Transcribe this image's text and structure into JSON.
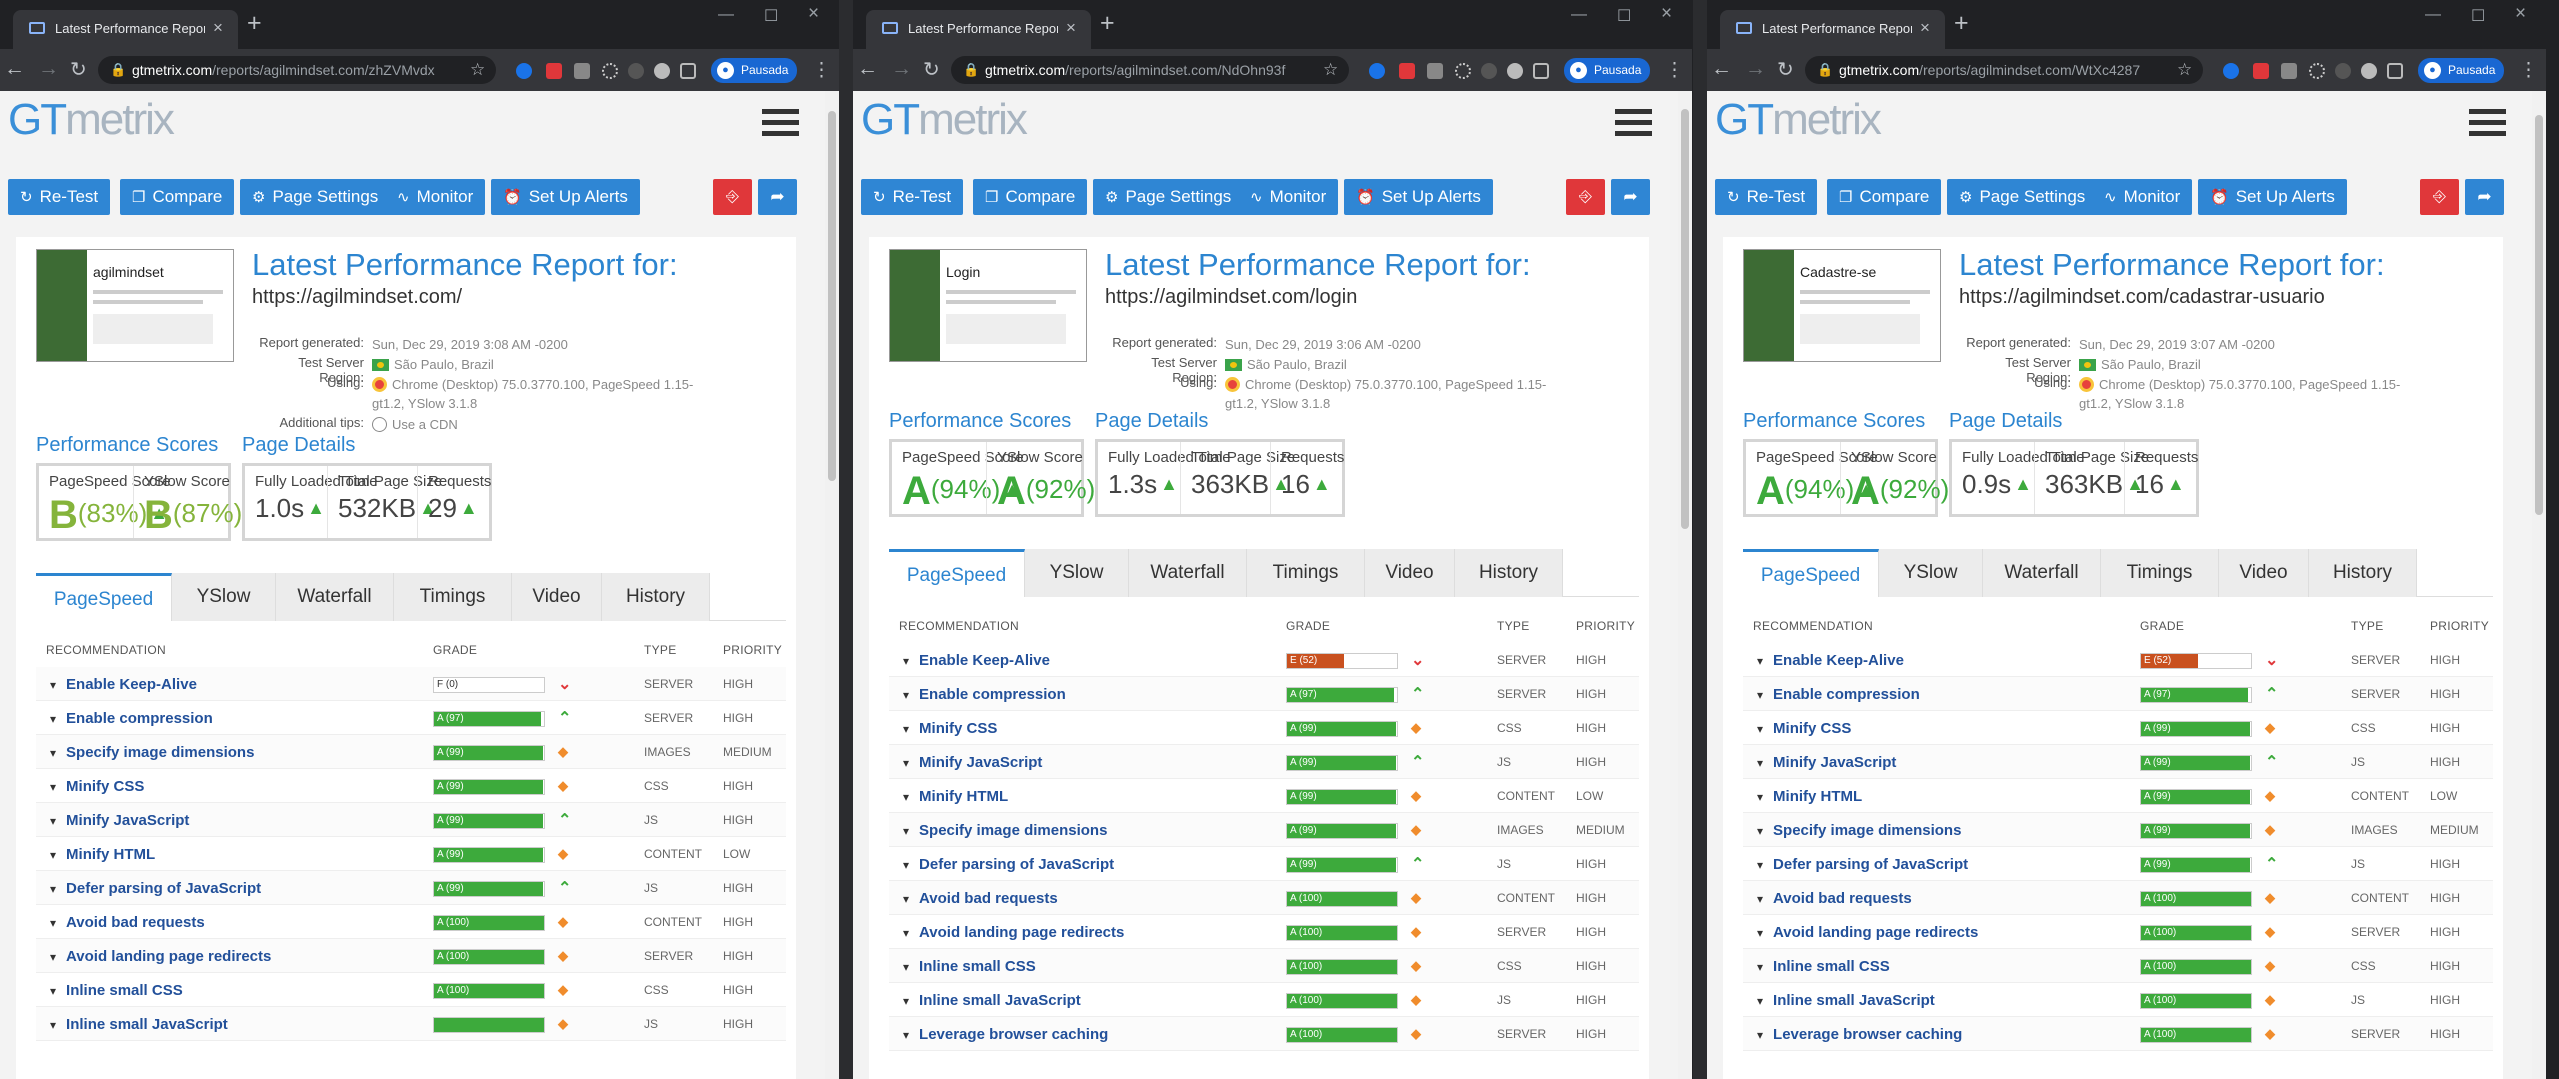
{
  "windows": [
    {
      "tab_title": "Latest Performance Report for: ht",
      "url_domain": "gtmetrix.com",
      "url_path": "/reports/agilmindset.com/zhZVMvdx",
      "pause_label": "Pausada",
      "logo_a": "GT",
      "logo_b": "metrix",
      "buttons": {
        "retest": "Re-Test",
        "compare": "Compare",
        "settings": "Page Settings",
        "monitor": "Monitor",
        "alerts": "Set Up Alerts"
      },
      "report_title": "Latest Performance Report for:",
      "report_url": "https://agilmindset.com/",
      "meta": {
        "generated_k": "Report generated:",
        "generated": "Sun, Dec 29, 2019 3:08 AM -0200",
        "region_k": "Test Server Region:",
        "region": "São Paulo, Brazil",
        "using_k": "Using:",
        "using": "Chrome (Desktop) 75.0.3770.100, PageSpeed 1.15-gt1.2, YSlow 3.1.8",
        "tips_k": "Additional tips:",
        "tips": "Use a CDN"
      },
      "thumb_text": "agilmindset",
      "perf_header": "Performance Scores",
      "details_header": "Page Details",
      "pagespeed_label": "PageSpeed Score",
      "pagespeed_grade": "B",
      "pagespeed_pct": "(83%)",
      "yslow_label": "YSlow Score",
      "yslow_grade": "B",
      "yslow_pct": "(87%)",
      "load_label": "Fully Loaded Time",
      "load": "1.0s",
      "size_label": "Total Page Size",
      "size": "532KB",
      "req_label": "Requests",
      "requests": "29",
      "tabs": [
        "PageSpeed",
        "YSlow",
        "Waterfall",
        "Timings",
        "Video",
        "History"
      ],
      "cols": {
        "rec": "RECOMMENDATION",
        "grade": "GRADE",
        "type": "TYPE",
        "priority": "PRIORITY"
      },
      "rows": [
        {
          "name": "Enable Keep-Alive",
          "grade": "F (0)",
          "score": 0,
          "type": "SERVER",
          "priority": "HIGH",
          "ind": "down"
        },
        {
          "name": "Enable compression",
          "grade": "A (97)",
          "score": 97,
          "type": "SERVER",
          "priority": "HIGH",
          "ind": "up"
        },
        {
          "name": "Specify image dimensions",
          "grade": "A (99)",
          "score": 99,
          "type": "IMAGES",
          "priority": "MEDIUM",
          "ind": "same"
        },
        {
          "name": "Minify CSS",
          "grade": "A (99)",
          "score": 99,
          "type": "CSS",
          "priority": "HIGH",
          "ind": "same"
        },
        {
          "name": "Minify JavaScript",
          "grade": "A (99)",
          "score": 99,
          "type": "JS",
          "priority": "HIGH",
          "ind": "up"
        },
        {
          "name": "Minify HTML",
          "grade": "A (99)",
          "score": 99,
          "type": "CONTENT",
          "priority": "LOW",
          "ind": "same"
        },
        {
          "name": "Defer parsing of JavaScript",
          "grade": "A (99)",
          "score": 99,
          "type": "JS",
          "priority": "HIGH",
          "ind": "up"
        },
        {
          "name": "Avoid bad requests",
          "grade": "A (100)",
          "score": 100,
          "type": "CONTENT",
          "priority": "HIGH",
          "ind": "same"
        },
        {
          "name": "Avoid landing page redirects",
          "grade": "A (100)",
          "score": 100,
          "type": "SERVER",
          "priority": "HIGH",
          "ind": "same"
        },
        {
          "name": "Inline small CSS",
          "grade": "A (100)",
          "score": 100,
          "type": "CSS",
          "priority": "HIGH",
          "ind": "same"
        },
        {
          "name": "Inline small JavaScript",
          "grade": "",
          "score": 100,
          "type": "JS",
          "priority": "HIGH",
          "ind": "same"
        }
      ]
    },
    {
      "tab_title": "Latest Performance Report for: ht",
      "url_domain": "gtmetrix.com",
      "url_path": "/reports/agilmindset.com/NdOhn93f",
      "pause_label": "Pausada",
      "logo_a": "GT",
      "logo_b": "metrix",
      "buttons": {
        "retest": "Re-Test",
        "compare": "Compare",
        "settings": "Page Settings",
        "monitor": "Monitor",
        "alerts": "Set Up Alerts"
      },
      "report_title": "Latest Performance Report for:",
      "report_url": "https://agilmindset.com/login",
      "meta": {
        "generated_k": "Report generated:",
        "generated": "Sun, Dec 29, 2019 3:06 AM -0200",
        "region_k": "Test Server Region:",
        "region": "São Paulo, Brazil",
        "using_k": "Using:",
        "using": "Chrome (Desktop) 75.0.3770.100, PageSpeed 1.15-gt1.2, YSlow 3.1.8",
        "tips_k": "",
        "tips": ""
      },
      "thumb_text": "Login",
      "perf_header": "Performance Scores",
      "details_header": "Page Details",
      "pagespeed_label": "PageSpeed Score",
      "pagespeed_grade": "A",
      "pagespeed_pct": "(94%)",
      "yslow_label": "YSlow Score",
      "yslow_grade": "A",
      "yslow_pct": "(92%)",
      "load_label": "Fully Loaded Time",
      "load": "1.3s",
      "size_label": "Total Page Size",
      "size": "363KB",
      "req_label": "Requests",
      "requests": "16",
      "tabs": [
        "PageSpeed",
        "YSlow",
        "Waterfall",
        "Timings",
        "Video",
        "History"
      ],
      "cols": {
        "rec": "RECOMMENDATION",
        "grade": "GRADE",
        "type": "TYPE",
        "priority": "PRIORITY"
      },
      "rows": [
        {
          "name": "Enable Keep-Alive",
          "grade": "E (52)",
          "score": 52,
          "type": "SERVER",
          "priority": "HIGH",
          "ind": "down"
        },
        {
          "name": "Enable compression",
          "grade": "A (97)",
          "score": 97,
          "type": "SERVER",
          "priority": "HIGH",
          "ind": "up"
        },
        {
          "name": "Minify CSS",
          "grade": "A (99)",
          "score": 99,
          "type": "CSS",
          "priority": "HIGH",
          "ind": "same"
        },
        {
          "name": "Minify JavaScript",
          "grade": "A (99)",
          "score": 99,
          "type": "JS",
          "priority": "HIGH",
          "ind": "up"
        },
        {
          "name": "Minify HTML",
          "grade": "A (99)",
          "score": 99,
          "type": "CONTENT",
          "priority": "LOW",
          "ind": "same"
        },
        {
          "name": "Specify image dimensions",
          "grade": "A (99)",
          "score": 99,
          "type": "IMAGES",
          "priority": "MEDIUM",
          "ind": "same"
        },
        {
          "name": "Defer parsing of JavaScript",
          "grade": "A (99)",
          "score": 99,
          "type": "JS",
          "priority": "HIGH",
          "ind": "up"
        },
        {
          "name": "Avoid bad requests",
          "grade": "A (100)",
          "score": 100,
          "type": "CONTENT",
          "priority": "HIGH",
          "ind": "same"
        },
        {
          "name": "Avoid landing page redirects",
          "grade": "A (100)",
          "score": 100,
          "type": "SERVER",
          "priority": "HIGH",
          "ind": "same"
        },
        {
          "name": "Inline small CSS",
          "grade": "A (100)",
          "score": 100,
          "type": "CSS",
          "priority": "HIGH",
          "ind": "same"
        },
        {
          "name": "Inline small JavaScript",
          "grade": "A (100)",
          "score": 100,
          "type": "JS",
          "priority": "HIGH",
          "ind": "same"
        },
        {
          "name": "Leverage browser caching",
          "grade": "A (100)",
          "score": 100,
          "type": "SERVER",
          "priority": "HIGH",
          "ind": "same"
        }
      ]
    },
    {
      "tab_title": "Latest Performance Report for: ht",
      "url_domain": "gtmetrix.com",
      "url_path": "/reports/agilmindset.com/WtXc4287",
      "pause_label": "Pausada",
      "logo_a": "GT",
      "logo_b": "metrix",
      "buttons": {
        "retest": "Re-Test",
        "compare": "Compare",
        "settings": "Page Settings",
        "monitor": "Monitor",
        "alerts": "Set Up Alerts"
      },
      "report_title": "Latest Performance Report for:",
      "report_url": "https://agilmindset.com/cadastrar-usuario",
      "meta": {
        "generated_k": "Report generated:",
        "generated": "Sun, Dec 29, 2019 3:07 AM -0200",
        "region_k": "Test Server Region:",
        "region": "São Paulo, Brazil",
        "using_k": "Using:",
        "using": "Chrome (Desktop) 75.0.3770.100, PageSpeed 1.15-gt1.2, YSlow 3.1.8",
        "tips_k": "",
        "tips": ""
      },
      "thumb_text": "Cadastre-se",
      "perf_header": "Performance Scores",
      "details_header": "Page Details",
      "pagespeed_label": "PageSpeed Score",
      "pagespeed_grade": "A",
      "pagespeed_pct": "(94%)",
      "yslow_label": "YSlow Score",
      "yslow_grade": "A",
      "yslow_pct": "(92%)",
      "load_label": "Fully Loaded Time",
      "load": "0.9s",
      "size_label": "Total Page Size",
      "size": "363KB",
      "req_label": "Requests",
      "requests": "16",
      "tabs": [
        "PageSpeed",
        "YSlow",
        "Waterfall",
        "Timings",
        "Video",
        "History"
      ],
      "cols": {
        "rec": "RECOMMENDATION",
        "grade": "GRADE",
        "type": "TYPE",
        "priority": "PRIORITY"
      },
      "rows": [
        {
          "name": "Enable Keep-Alive",
          "grade": "E (52)",
          "score": 52,
          "type": "SERVER",
          "priority": "HIGH",
          "ind": "down"
        },
        {
          "name": "Enable compression",
          "grade": "A (97)",
          "score": 97,
          "type": "SERVER",
          "priority": "HIGH",
          "ind": "up"
        },
        {
          "name": "Minify CSS",
          "grade": "A (99)",
          "score": 99,
          "type": "CSS",
          "priority": "HIGH",
          "ind": "same"
        },
        {
          "name": "Minify JavaScript",
          "grade": "A (99)",
          "score": 99,
          "type": "JS",
          "priority": "HIGH",
          "ind": "up"
        },
        {
          "name": "Minify HTML",
          "grade": "A (99)",
          "score": 99,
          "type": "CONTENT",
          "priority": "LOW",
          "ind": "same"
        },
        {
          "name": "Specify image dimensions",
          "grade": "A (99)",
          "score": 99,
          "type": "IMAGES",
          "priority": "MEDIUM",
          "ind": "same"
        },
        {
          "name": "Defer parsing of JavaScript",
          "grade": "A (99)",
          "score": 99,
          "type": "JS",
          "priority": "HIGH",
          "ind": "up"
        },
        {
          "name": "Avoid bad requests",
          "grade": "A (100)",
          "score": 100,
          "type": "CONTENT",
          "priority": "HIGH",
          "ind": "same"
        },
        {
          "name": "Avoid landing page redirects",
          "grade": "A (100)",
          "score": 100,
          "type": "SERVER",
          "priority": "HIGH",
          "ind": "same"
        },
        {
          "name": "Inline small CSS",
          "grade": "A (100)",
          "score": 100,
          "type": "CSS",
          "priority": "HIGH",
          "ind": "same"
        },
        {
          "name": "Inline small JavaScript",
          "grade": "A (100)",
          "score": 100,
          "type": "JS",
          "priority": "HIGH",
          "ind": "same"
        },
        {
          "name": "Leverage browser caching",
          "grade": "A (100)",
          "score": 100,
          "type": "SERVER",
          "priority": "HIGH",
          "ind": "same"
        }
      ]
    }
  ],
  "colors": {
    "accent": "#2f86d4",
    "grade_a": "#3daa3c",
    "grade_e": "#c9511f",
    "pdf": "#e0373a"
  },
  "icons": {
    "pdf": "pdf-icon",
    "share": "share-icon"
  }
}
